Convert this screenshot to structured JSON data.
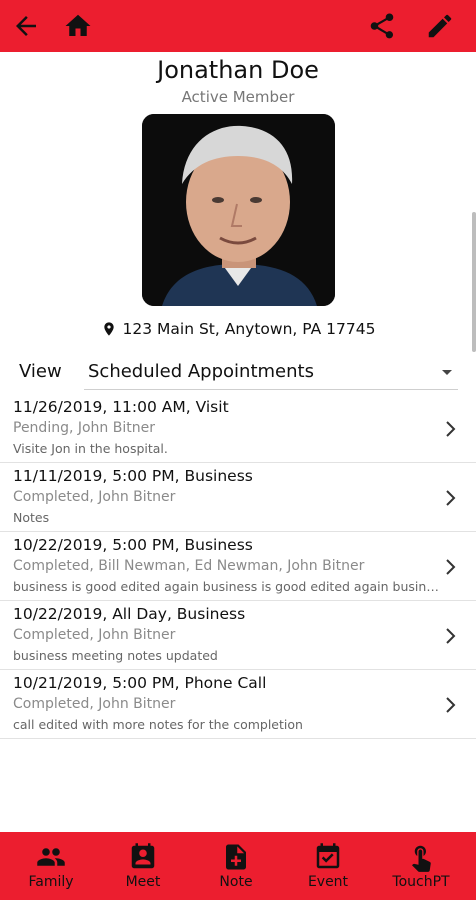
{
  "header": {
    "back_icon": "arrow-left-icon",
    "home_icon": "home-icon",
    "share_icon": "share-icon",
    "edit_icon": "pencil-icon",
    "bar_color": "#ec1e2f"
  },
  "profile": {
    "name": "Jonathan Doe",
    "status": "Active Member",
    "address": "123 Main St, Anytown, PA 17745",
    "address_icon": "location-pin-icon"
  },
  "view_filter": {
    "label": "View",
    "selected": "Scheduled Appointments"
  },
  "appointments": [
    {
      "title": "11/26/2019, 11:00 AM, Visit",
      "people": "Pending, John Bitner",
      "notes": "Visite Jon in the hospital."
    },
    {
      "title": "11/11/2019, 5:00 PM, Business",
      "people": "Completed, John Bitner",
      "notes": "Notes"
    },
    {
      "title": "10/22/2019, 5:00 PM, Business",
      "people": "Completed, Bill Newman, Ed Newman, John Bitner",
      "notes": "business is good edited again business is good edited again business is good"
    },
    {
      "title": "10/22/2019, All Day, Business",
      "people": "Completed, John Bitner",
      "notes": "business meeting notes updated"
    },
    {
      "title": "10/21/2019, 5:00 PM, Phone Call",
      "people": "Completed, John Bitner",
      "notes": "call edited with more notes for the completion"
    }
  ],
  "bottom_nav": [
    {
      "label": "Family",
      "icon": "family-icon"
    },
    {
      "label": "Meet",
      "icon": "meet-icon"
    },
    {
      "label": "Note",
      "icon": "note-add-icon"
    },
    {
      "label": "Event",
      "icon": "event-icon"
    },
    {
      "label": "TouchPT",
      "icon": "touch-icon"
    }
  ]
}
